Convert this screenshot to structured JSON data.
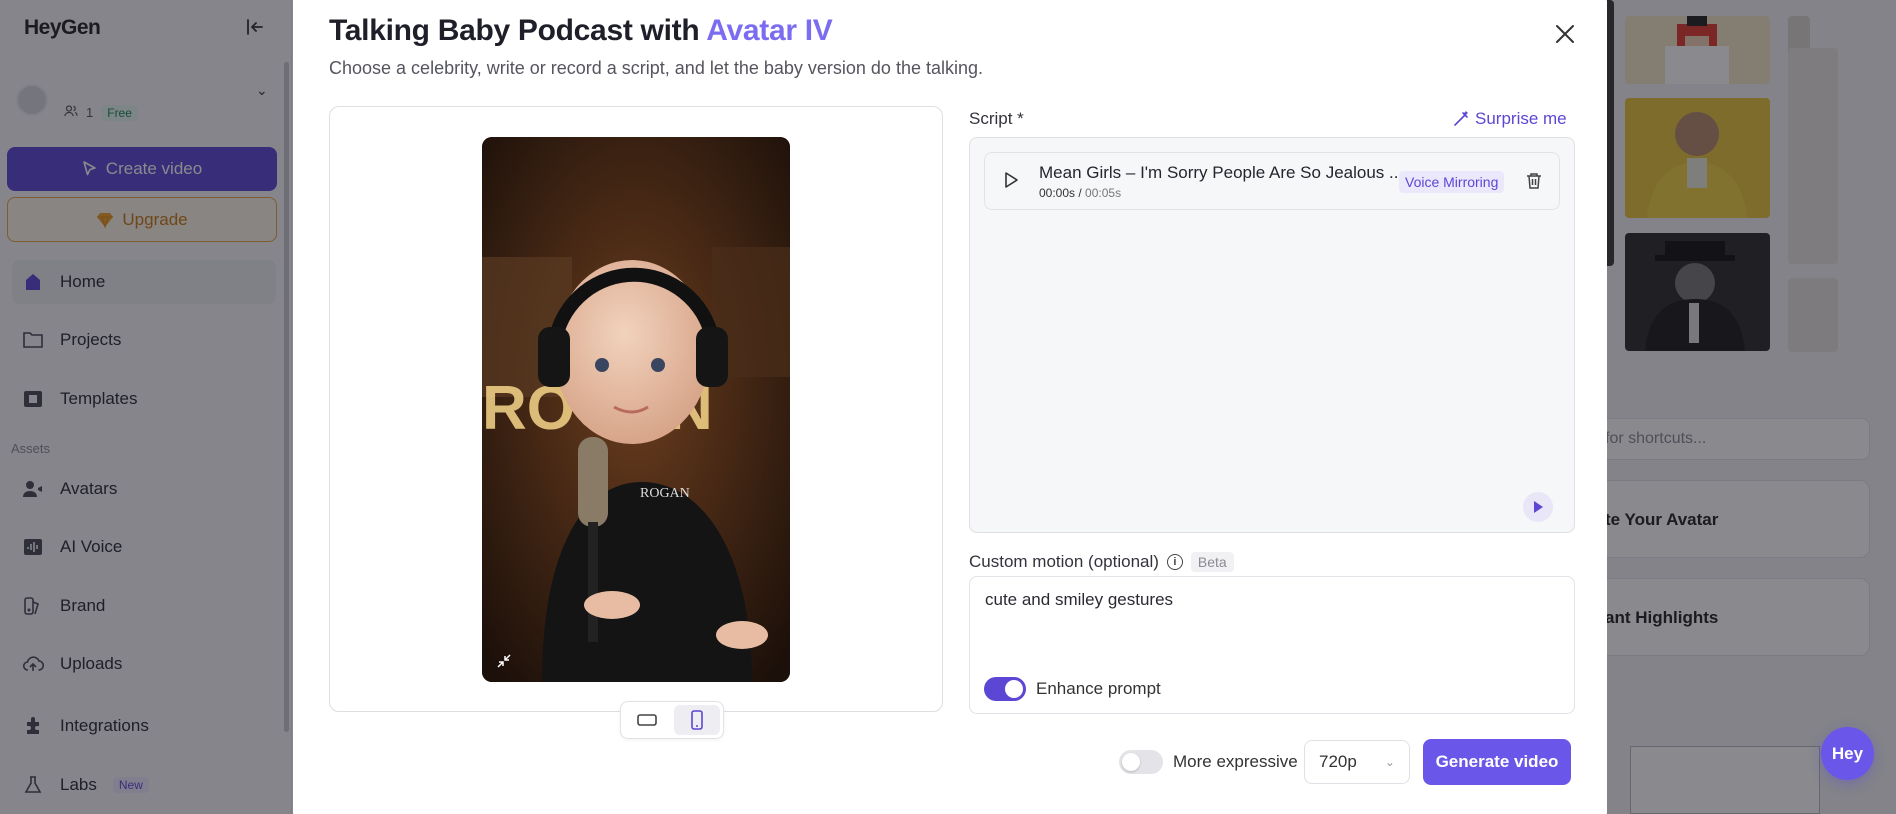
{
  "app": {
    "logo_text": "HeyGen"
  },
  "workspace": {
    "member_count": "1",
    "plan": "Free"
  },
  "sidebar": {
    "create_label": "Create video",
    "upgrade_label": "Upgrade",
    "assets_section_label": "Assets",
    "items": [
      {
        "label": "Home",
        "icon": "home-icon",
        "active": true
      },
      {
        "label": "Projects",
        "icon": "folder-icon"
      },
      {
        "label": "Templates",
        "icon": "film-icon"
      },
      {
        "label": "Avatars",
        "icon": "avatar-icon"
      },
      {
        "label": "AI Voice",
        "icon": "voice-icon"
      },
      {
        "label": "Brand",
        "icon": "brand-icon"
      },
      {
        "label": "Uploads",
        "icon": "upload-icon"
      },
      {
        "label": "Integrations",
        "icon": "integration-icon"
      },
      {
        "label": "Labs",
        "icon": "labs-icon",
        "badge": "New"
      }
    ]
  },
  "background": {
    "shortcut_placeholder": "for shortcuts...",
    "card1": "te Your Avatar",
    "card2": "ant Highlights",
    "fab_label": "Hey"
  },
  "modal": {
    "title_prefix": "Talking Baby Podcast with",
    "title_accent": "Avatar IV",
    "subtitle": "Choose a celebrity, write or record a script, and let the baby version do the talking.",
    "close_icon": "close-icon",
    "accent_color": "#7b6cf0"
  },
  "preview": {
    "orientation_options": [
      "landscape",
      "portrait"
    ],
    "selected_orientation": "portrait"
  },
  "script": {
    "label": "Script *",
    "surprise_label": "Surprise me",
    "audio": {
      "title": "Mean Girls – I'm Sorry People Are So Jealous ...",
      "current_time": "00:00s",
      "duration": "00:05s",
      "badge": "Voice Mirroring"
    }
  },
  "motion": {
    "label": "Custom motion (optional)",
    "beta_label": "Beta",
    "value": "cute and smiley gestures",
    "enhance_label": "Enhance prompt",
    "enhance_on": true
  },
  "footer": {
    "expressive_label": "More expressive",
    "expressive_on": false,
    "quality_value": "720p",
    "generate_label": "Generate video"
  }
}
